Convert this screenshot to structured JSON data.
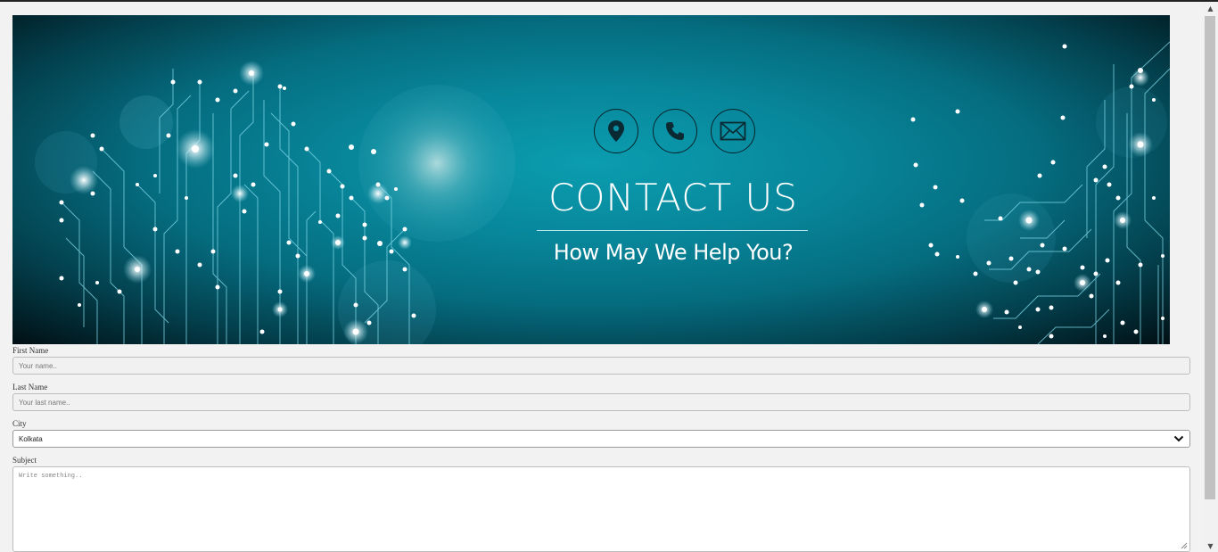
{
  "banner": {
    "title": "CONTACT US",
    "subtitle": "How May We Help You?",
    "icons": [
      "location-pin-icon",
      "phone-icon",
      "envelope-icon"
    ],
    "colors": {
      "teal": "#0b9db0",
      "dark": "#010f14",
      "circuit": "#7fd8e8"
    }
  },
  "form": {
    "first_name": {
      "label": "First Name",
      "placeholder": "Your name.."
    },
    "last_name": {
      "label": "Last Name",
      "placeholder": "Your last name.."
    },
    "city": {
      "label": "City",
      "value": "Kolkata"
    },
    "subject": {
      "label": "Subject",
      "placeholder": "Write something.."
    }
  }
}
